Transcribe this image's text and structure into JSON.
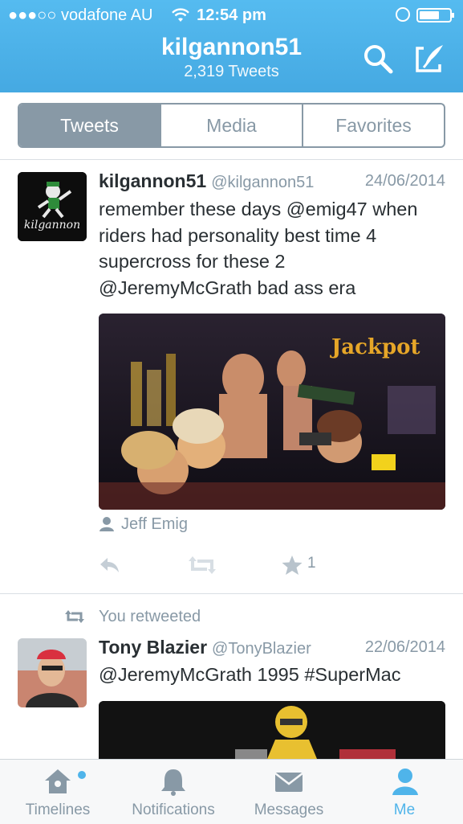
{
  "status": {
    "carrier": "●●●○○ vodafone AU",
    "time": "12:54 pm"
  },
  "header": {
    "title": "kilgannon51",
    "subtitle": "2,319 Tweets"
  },
  "segments": [
    "Tweets",
    "Media",
    "Favorites"
  ],
  "tweets": [
    {
      "name": "kilgannon51",
      "handle": "@kilgannon51",
      "date": "24/06/2014",
      "avatar_text": "kilgannon",
      "lines": [
        "remember these days @emig47 when",
        "riders had personality best time 4",
        "supercross for these 2",
        "@JeremyMcGrath bad ass era"
      ],
      "media_text": "Jackpot",
      "tagged": "Jeff Emig",
      "favorites": "1"
    },
    {
      "retweet_label": "You retweeted",
      "name": "Tony Blazier",
      "handle": "@TonyBlazier",
      "date": "22/06/2014",
      "lines": [
        "@JeremyMcGrath 1995 #SuperMac"
      ]
    }
  ],
  "tabs": [
    "Timelines",
    "Notifications",
    "Messages",
    "Me"
  ],
  "colors": {
    "accent": "#4fb4ea",
    "muted": "#8899a6",
    "text": "#292f33"
  }
}
